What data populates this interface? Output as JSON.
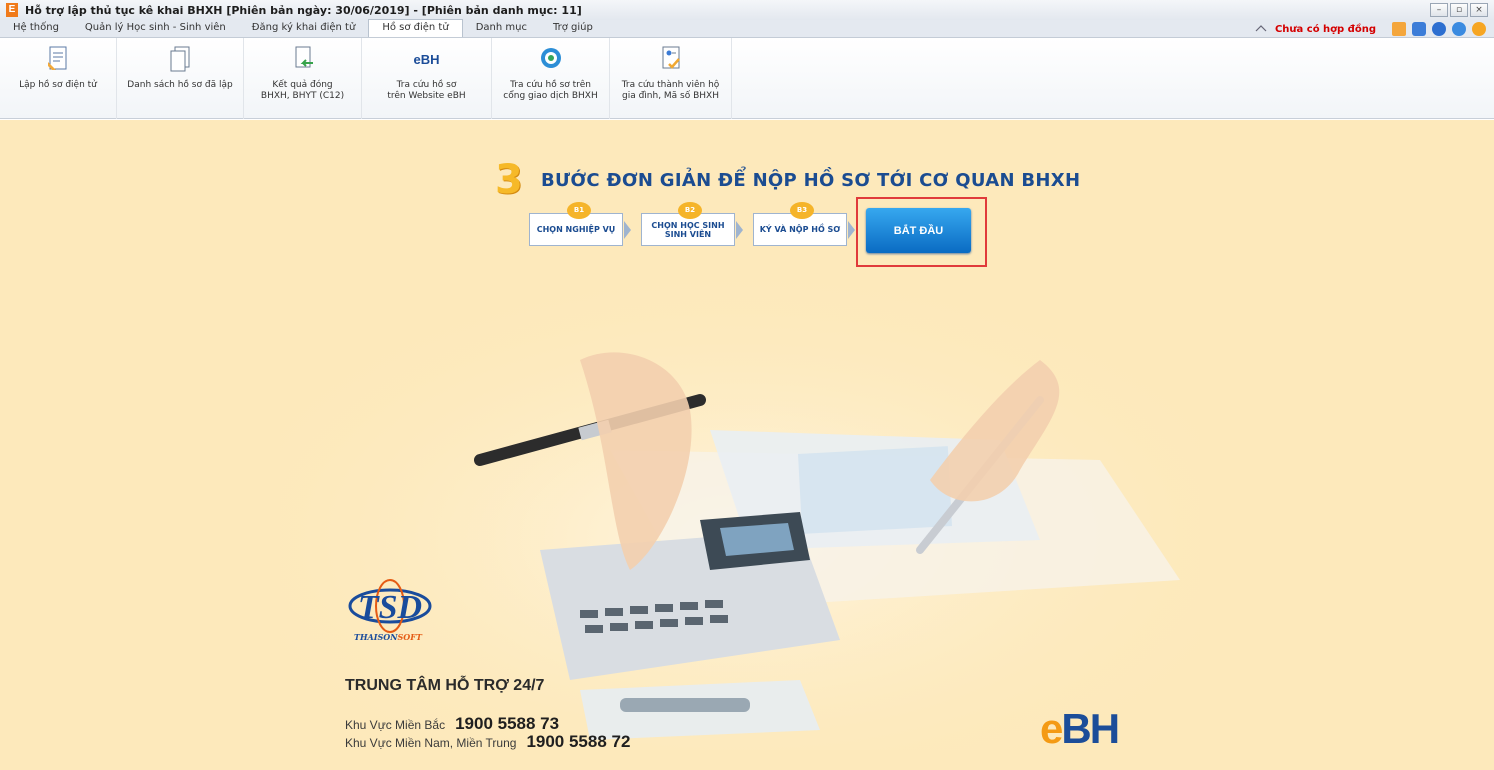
{
  "window": {
    "logo_letter": "E",
    "title": "Hỗ trợ lập thủ tục kê khai BHXH [Phiên bản ngày: 30/06/2019] - [Phiên bản danh mục: 11]",
    "controls": [
      "–",
      "▫",
      "×"
    ]
  },
  "tabs": [
    {
      "label": "Hệ thống"
    },
    {
      "label": "Quản lý Học sinh - Sinh viên"
    },
    {
      "label": "Đăng ký khai điện tử"
    },
    {
      "label": "Hồ sơ điện tử"
    },
    {
      "label": "Danh mục"
    },
    {
      "label": "Trợ giúp"
    }
  ],
  "status": {
    "contract": "Chưa có hợp đồng"
  },
  "ribbon": [
    {
      "label": "Lập hồ sơ điện tử",
      "icon": "document-edit-icon"
    },
    {
      "label": "Danh sách hồ sơ đã lập",
      "icon": "document-list-icon"
    },
    {
      "label": "Kết quả đóng\nBHXH, BHYT (C12)",
      "icon": "result-arrow-icon"
    },
    {
      "label": "Tra cứu hồ sơ\ntrên Website eBH",
      "icon": "ebh-icon",
      "icon_text": "eBH"
    },
    {
      "label": "Tra cứu hồ sơ trên\ncổng giao dịch BHXH",
      "icon": "portal-icon"
    },
    {
      "label": "Tra cứu thành viên hộ\ngia đình, Mã số BHXH",
      "icon": "family-check-icon"
    }
  ],
  "steps": {
    "number": "3",
    "title": "BƯỚC ĐƠN GIẢN ĐỂ NỘP HỒ SƠ TỚI CƠ QUAN BHXH",
    "items": [
      {
        "badge": "B1",
        "label": "CHỌN NGHIỆP VỤ"
      },
      {
        "badge": "B2",
        "label": "CHỌN HỌC SINH SINH VIÊN"
      },
      {
        "badge": "B3",
        "label": "KÝ VÀ NỘP HỒ SƠ"
      }
    ],
    "start": "BẮT ĐẦU"
  },
  "company": {
    "logo": "TSD",
    "name_a": "THAISON",
    "name_b": "SOFT"
  },
  "support": {
    "title": "TRUNG TÂM HỖ TRỢ 24/7",
    "north_label": "Khu Vực Miền Bắc",
    "north_phone": "1900 5588 73",
    "south_label": "Khu Vực Miền Nam, Miền Trung",
    "south_phone": "1900 5588 72"
  },
  "brand": {
    "e": "e",
    "rest": "BH"
  },
  "colors": {
    "accent": "#1b4c91",
    "background": "#fde9bb",
    "button": "#1679d2",
    "contract": "#d40000",
    "highlight": "#e03a3a"
  }
}
